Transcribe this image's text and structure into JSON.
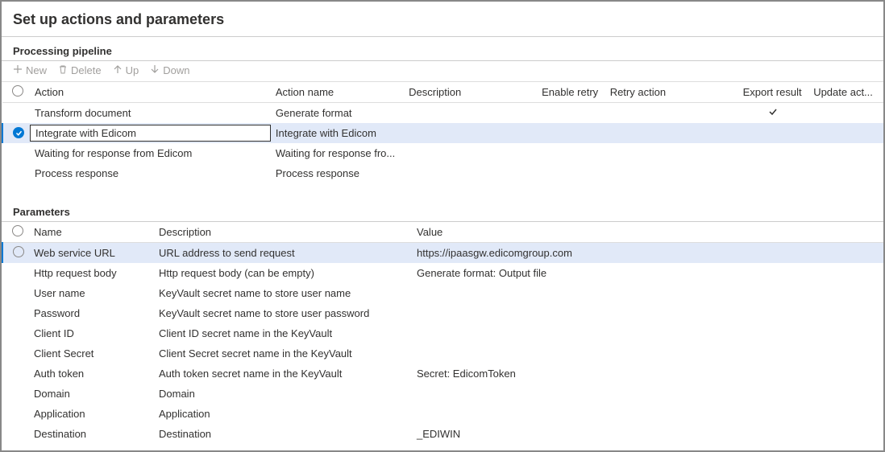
{
  "page_title": "Set up actions and parameters",
  "pipeline_section_title": "Processing pipeline",
  "parameters_section_title": "Parameters",
  "toolbar": {
    "new_label": "New",
    "delete_label": "Delete",
    "up_label": "Up",
    "down_label": "Down"
  },
  "actions_columns": {
    "action": "Action",
    "action_name": "Action name",
    "description": "Description",
    "enable_retry": "Enable retry",
    "retry_action": "Retry action",
    "export_result": "Export result",
    "update_act": "Update act..."
  },
  "actions_rows": [
    {
      "action": "Transform document",
      "action_name": "Generate format",
      "export_result": true,
      "selected": false
    },
    {
      "action": "Integrate with Edicom",
      "action_name": "Integrate with Edicom",
      "export_result": false,
      "selected": true
    },
    {
      "action": "Waiting for response from Edicom",
      "action_name": "Waiting for response fro...",
      "export_result": false,
      "selected": false
    },
    {
      "action": "Process response",
      "action_name": "Process response",
      "export_result": false,
      "selected": false
    }
  ],
  "params_columns": {
    "name": "Name",
    "description": "Description",
    "value": "Value"
  },
  "params_rows": [
    {
      "name": "Web service URL",
      "description": "URL address to send request",
      "value": "https://ipaasgw.edicomgroup.com",
      "selected": true
    },
    {
      "name": "Http request body",
      "description": "Http request body (can be empty)",
      "value": "Generate format: Output file",
      "selected": false
    },
    {
      "name": "User name",
      "description": "KeyVault secret name to store user name",
      "value": "",
      "selected": false
    },
    {
      "name": "Password",
      "description": "KeyVault secret name to store user password",
      "value": "",
      "selected": false
    },
    {
      "name": "Client ID",
      "description": "Client ID secret name in the KeyVault",
      "value": "",
      "selected": false
    },
    {
      "name": "Client Secret",
      "description": "Client Secret secret name in the KeyVault",
      "value": "",
      "selected": false
    },
    {
      "name": "Auth token",
      "description": "Auth token secret name in the KeyVault",
      "value": "Secret:  EdicomToken",
      "selected": false
    },
    {
      "name": "Domain",
      "description": "Domain",
      "value": "",
      "selected": false
    },
    {
      "name": "Application",
      "description": "Application",
      "value": "",
      "selected": false
    },
    {
      "name": "Destination",
      "description": "Destination",
      "value": "_EDIWIN",
      "selected": false
    }
  ]
}
